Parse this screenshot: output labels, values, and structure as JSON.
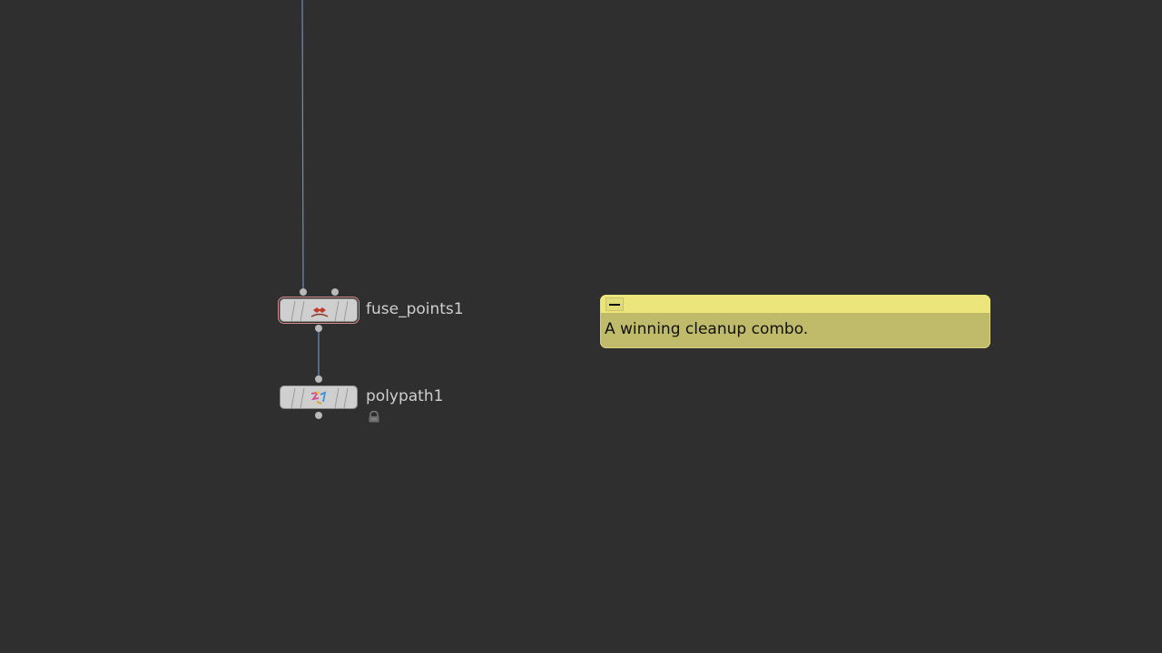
{
  "network": {
    "nodes": [
      {
        "name": "fuse_points1",
        "icon": "fuse-points-icon",
        "selected": true,
        "locked": false
      },
      {
        "name": "polypath1",
        "icon": "polypath-icon",
        "selected": false,
        "locked": true
      }
    ],
    "wire_color": "#6f8fb8"
  },
  "sticky_note": {
    "text": "A winning cleanup combo.",
    "color": "#ece57b"
  }
}
